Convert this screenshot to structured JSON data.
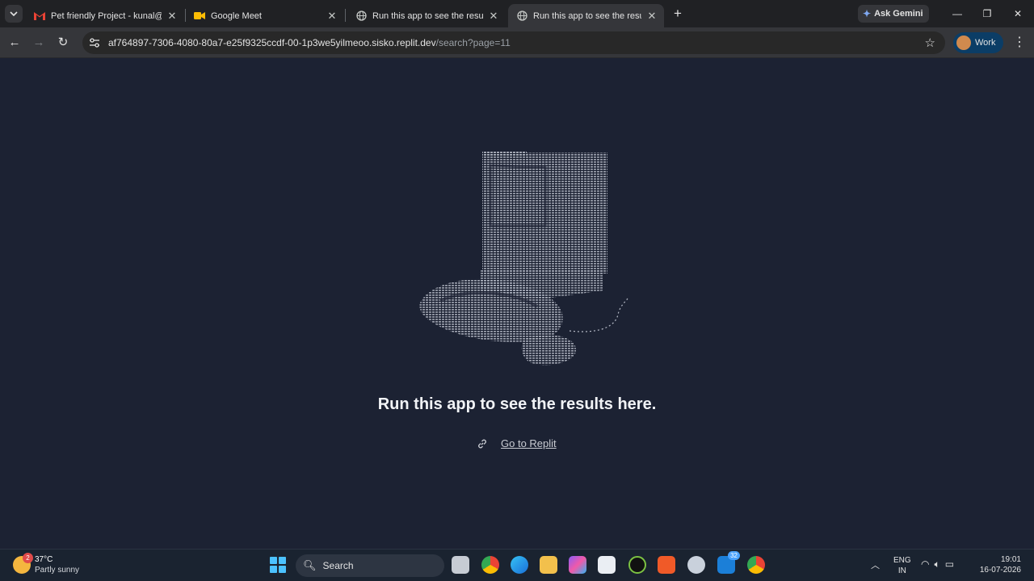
{
  "browser": {
    "tabs": [
      {
        "title": "Pet friendly Project - kunal@cv",
        "icon": "gmail-icon",
        "active": false
      },
      {
        "title": "Google Meet",
        "icon": "meet-icon",
        "active": false
      },
      {
        "title": "Run this app to see the results h",
        "icon": "globe-icon",
        "active": false
      },
      {
        "title": "Run this app to see the results h",
        "icon": "globe-icon",
        "active": true
      }
    ],
    "gemini_label": "Ask Gemini",
    "url_host": "af764897-7306-4080-80a7-e25f9325ccdf-00-1p3we5yilmeoo.sisko.replit.dev",
    "url_path": "/search?page=11",
    "profile_label": "Work"
  },
  "page": {
    "message": "Run this app to see the results here.",
    "link_label": "Go to Replit"
  },
  "taskbar": {
    "weather_badge": "2",
    "temperature": "37°C",
    "condition": "Partly sunny",
    "search_label": "Search",
    "outlook_badge": "32",
    "lang_top": "ENG",
    "lang_bottom": "IN",
    "time": "19:01",
    "date": "16-07-2026"
  },
  "colors": {
    "page_bg": "#1c2233",
    "tab_strip": "#202124",
    "toolbar": "#35363a",
    "art": "#b7bcc8",
    "profile_chip": "#0b3d66"
  }
}
